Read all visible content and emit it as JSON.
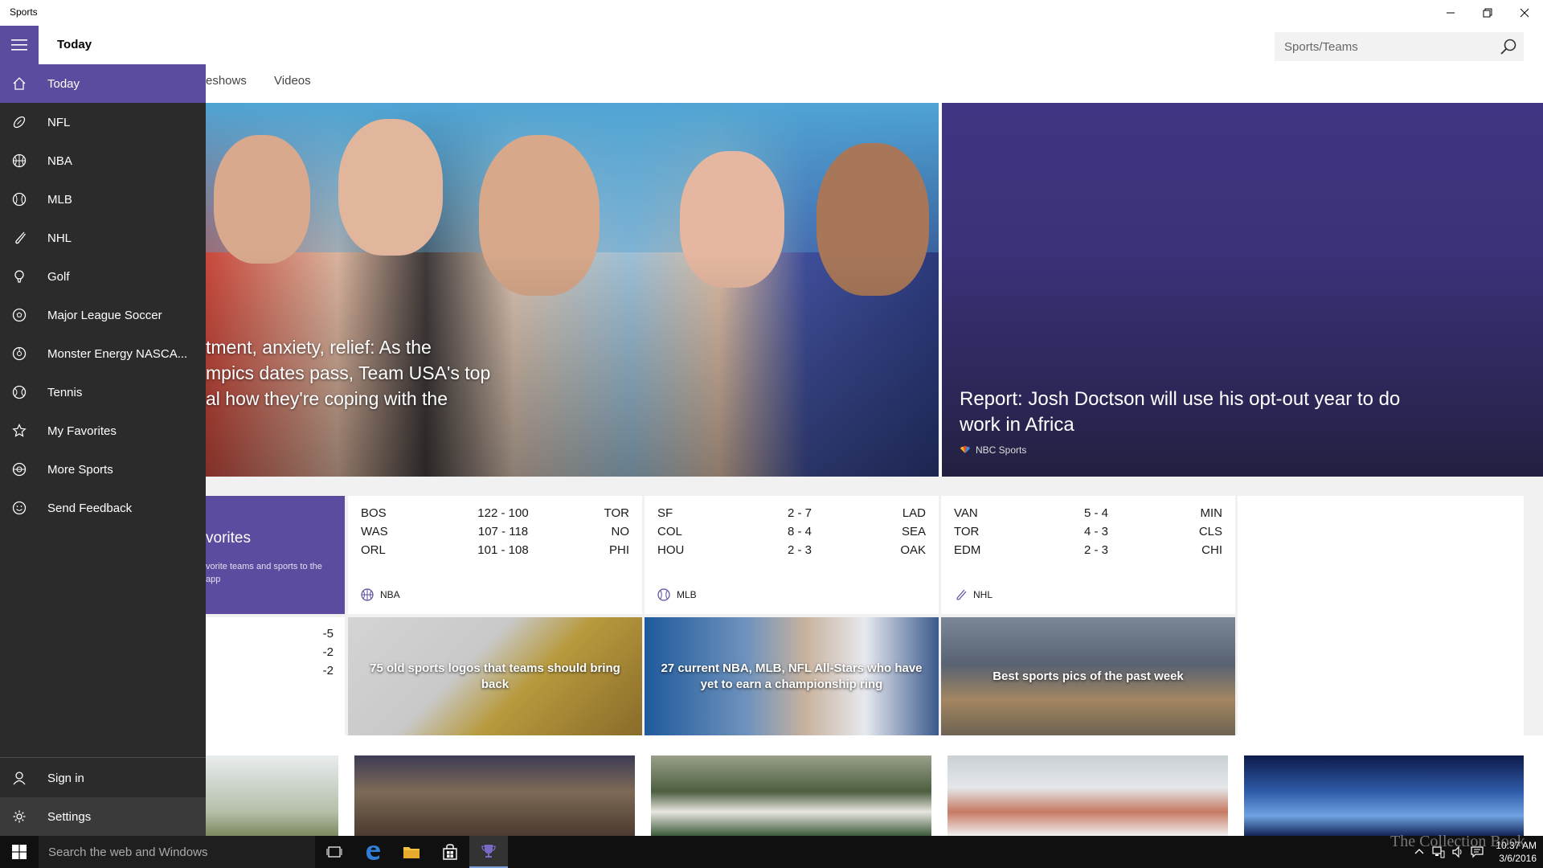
{
  "window": {
    "title": "Sports"
  },
  "header": {
    "title": "Today",
    "search_placeholder": "Sports/Teams"
  },
  "subnav": [
    "eshows",
    "Videos"
  ],
  "nav": {
    "items": [
      {
        "label": "Today",
        "icon": "home-icon",
        "active": true
      },
      {
        "label": "NFL",
        "icon": "football-icon"
      },
      {
        "label": "NBA",
        "icon": "basketball-icon"
      },
      {
        "label": "MLB",
        "icon": "baseball-icon"
      },
      {
        "label": "NHL",
        "icon": "hockey-icon"
      },
      {
        "label": "Golf",
        "icon": "golf-icon"
      },
      {
        "label": "Major League Soccer",
        "icon": "soccer-icon"
      },
      {
        "label": "Monster Energy NASCA...",
        "icon": "racing-icon"
      },
      {
        "label": "Tennis",
        "icon": "tennis-icon"
      },
      {
        "label": "My Favorites",
        "icon": "favorites-icon"
      },
      {
        "label": "More Sports",
        "icon": "more-sports-icon"
      },
      {
        "label": "Send Feedback",
        "icon": "feedback-icon"
      }
    ],
    "bottom": [
      {
        "label": "Sign in",
        "icon": "person-icon"
      },
      {
        "label": "Settings",
        "icon": "gear-icon"
      }
    ]
  },
  "hero": {
    "main_headline": "tment, anxiety, relief: As the\nmpics dates pass, Team USA's top\nal how they're coping with the",
    "side_headline": "Report: Josh Doctson will use his opt-out year to do work in Africa",
    "side_source": "NBC Sports"
  },
  "favorites_card": {
    "title": "vorites",
    "desc": "vorite teams and sports to the app"
  },
  "scores": [
    {
      "league": "NBA",
      "icon": "basketball-icon",
      "games": [
        {
          "away": "BOS",
          "score": "122  -  100",
          "home": "TOR"
        },
        {
          "away": "WAS",
          "score": "107  -  118",
          "home": "NO"
        },
        {
          "away": "ORL",
          "score": "101  -  108",
          "home": "PHI"
        }
      ]
    },
    {
      "league": "MLB",
      "icon": "baseball-icon",
      "games": [
        {
          "away": "SF",
          "score": "2  -  7",
          "home": "LAD"
        },
        {
          "away": "COL",
          "score": "8  -  4",
          "home": "SEA"
        },
        {
          "away": "HOU",
          "score": "2  -  3",
          "home": "OAK"
        }
      ]
    },
    {
      "league": "NHL",
      "icon": "hockey-icon",
      "games": [
        {
          "away": "VAN",
          "score": "5  -  4",
          "home": "MIN"
        },
        {
          "away": "TOR",
          "score": "4  -  3",
          "home": "CLS"
        },
        {
          "away": "EDM",
          "score": "2  -  3",
          "home": "CHI"
        }
      ]
    }
  ],
  "partial_values": [
    "-5",
    "-2",
    "-2"
  ],
  "photo_cards": [
    {
      "caption": "75 old sports logos that teams should bring back"
    },
    {
      "caption": "27 current NBA, MLB, NFL All-Stars who have yet to earn a championship ring"
    },
    {
      "caption": "Best sports pics of the past week"
    }
  ],
  "taskbar": {
    "search_placeholder": "Search the web and Windows",
    "time": "10:37 AM",
    "date": "3/6/2016",
    "watermark": "The Collection Book"
  },
  "colors": {
    "accent": "#5c4b9e",
    "nav_bg": "#2b2b2b",
    "taskbar_bg": "#101010"
  }
}
